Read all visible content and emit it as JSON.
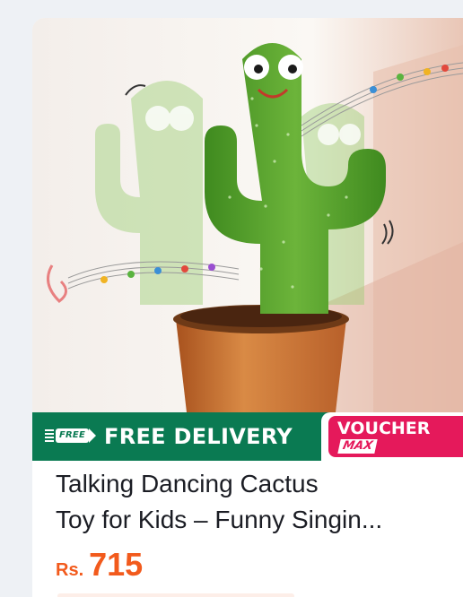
{
  "product": {
    "image_alt": "Talking Dancing Cactus toy in a brown pot",
    "title_line1": "Talking Dancing Cactus",
    "title_line2": "Toy for Kids – Funny Singin...",
    "currency": "Rs.",
    "price": "715"
  },
  "banner": {
    "free_badge": "FREE",
    "delivery_label": "FREE DELIVERY",
    "voucher_label": "VOUCHER",
    "voucher_tag": "MAX"
  },
  "colors": {
    "banner_green": "#0a7a52",
    "voucher_pink": "#e5195b",
    "price_orange": "#f25a1c",
    "title_text": "#1b1d24"
  },
  "icons": {
    "free_delivery": "truck-icon",
    "music": "music-notes-icon"
  }
}
